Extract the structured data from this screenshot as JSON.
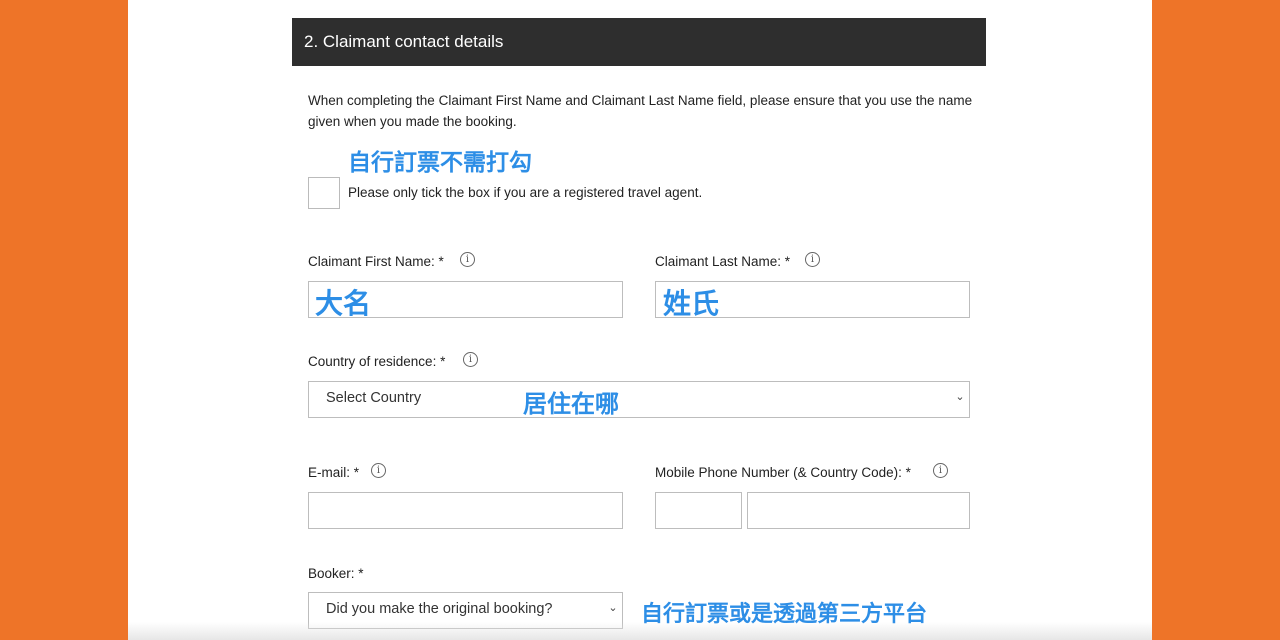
{
  "section": {
    "title": "2. Claimant contact details"
  },
  "intro_text": "When completing the Claimant First Name and Claimant Last Name field, please ensure that you use the name given when you made the booking.",
  "agent_checkbox": {
    "label": "Please only tick the box if you are a registered travel agent.",
    "checked": false
  },
  "first_name": {
    "label": "Claimant First Name: *",
    "value": ""
  },
  "last_name": {
    "label": "Claimant Last Name: *",
    "value": ""
  },
  "country": {
    "label": "Country of residence: *",
    "selected": "Select Country"
  },
  "email": {
    "label": "E-mail: *",
    "value": ""
  },
  "mobile": {
    "label": "Mobile Phone Number (& Country Code): *",
    "code": "",
    "number": ""
  },
  "booker": {
    "label": "Booker: *",
    "selected": "Did you make the original booking?"
  },
  "annotations": {
    "checkbox_note": "自行訂票不需打勾",
    "first_name_note": "大名",
    "last_name_note": "姓氏",
    "country_note": "居住在哪",
    "booker_note": "自行訂票或是透過第三方平台"
  },
  "info_icon": {
    "glyph": "i",
    "name": "info-icon"
  },
  "chevron": {
    "glyph": "⌄",
    "name": "chevron-down-icon"
  },
  "colors": {
    "background": "#ee7428",
    "header": "#2e2e2e",
    "annotation": "#2d8ee6"
  }
}
